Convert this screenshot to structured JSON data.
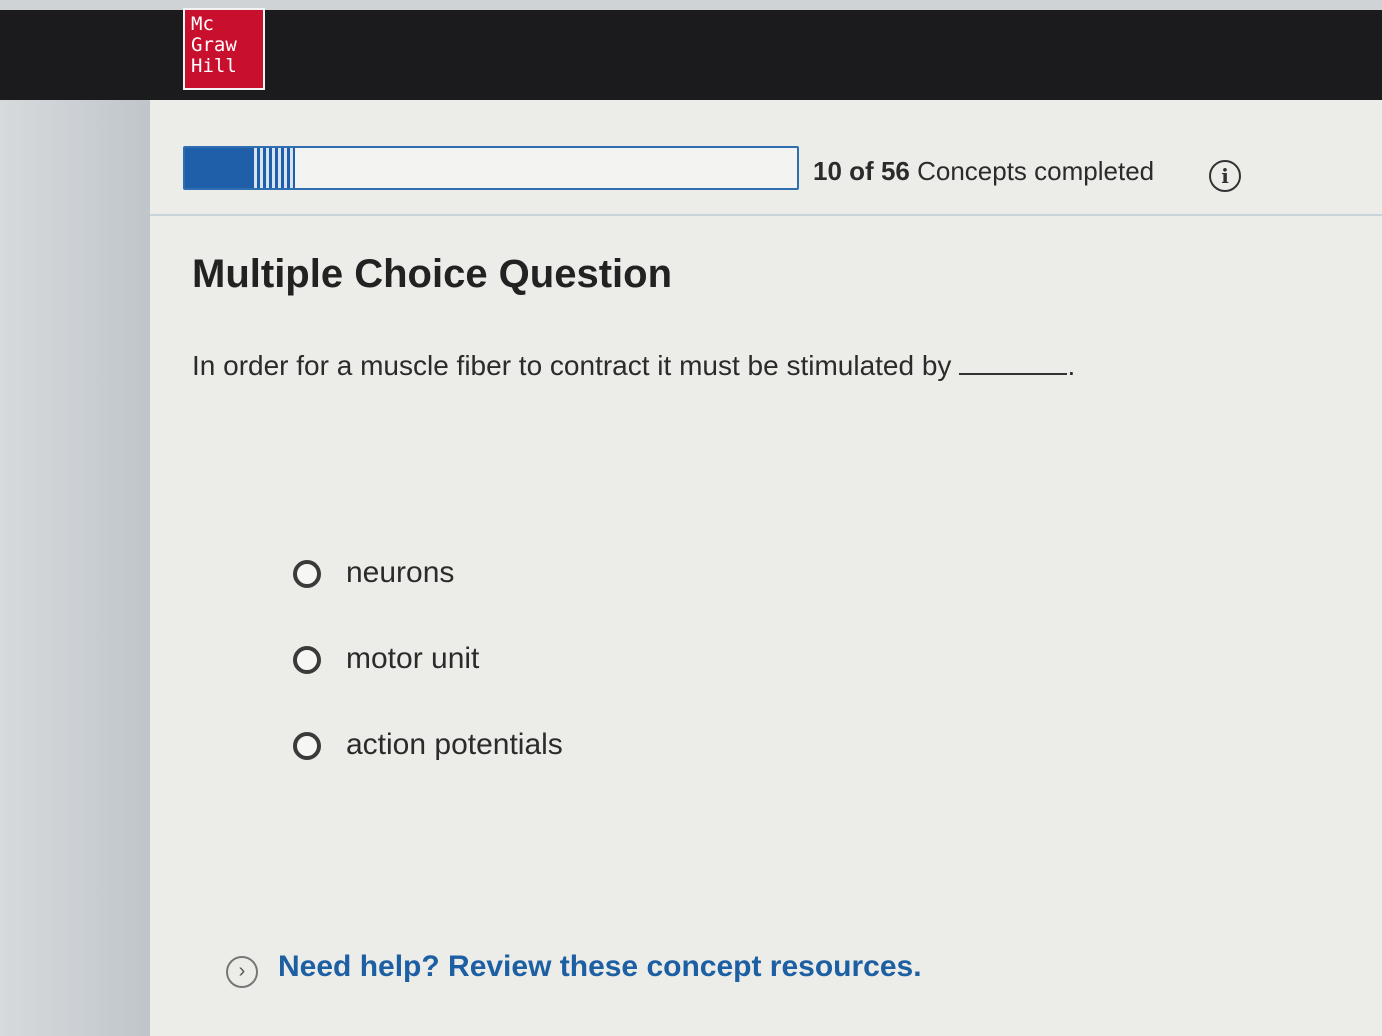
{
  "header": {
    "logo_lines": [
      "Mc",
      "Graw",
      "Hill"
    ]
  },
  "progress": {
    "completed": "10",
    "of_label": "of",
    "total": "56",
    "suffix": "Concepts completed",
    "fraction": 0.18
  },
  "question": {
    "heading": "Multiple Choice Question",
    "prompt": "In order for a muscle fiber to contract it must be stimulated by",
    "prompt_end": "."
  },
  "choices": [
    {
      "label": "neurons"
    },
    {
      "label": "motor unit"
    },
    {
      "label": "action potentials"
    }
  ],
  "help": {
    "link_text": "Need help? Review these concept resources."
  },
  "icons": {
    "info": "info-icon",
    "help": "chevron-right-icon"
  },
  "colors": {
    "brand_red": "#c8102e",
    "progress_blue": "#1f5ea8",
    "link_blue": "#1d5fa3"
  }
}
